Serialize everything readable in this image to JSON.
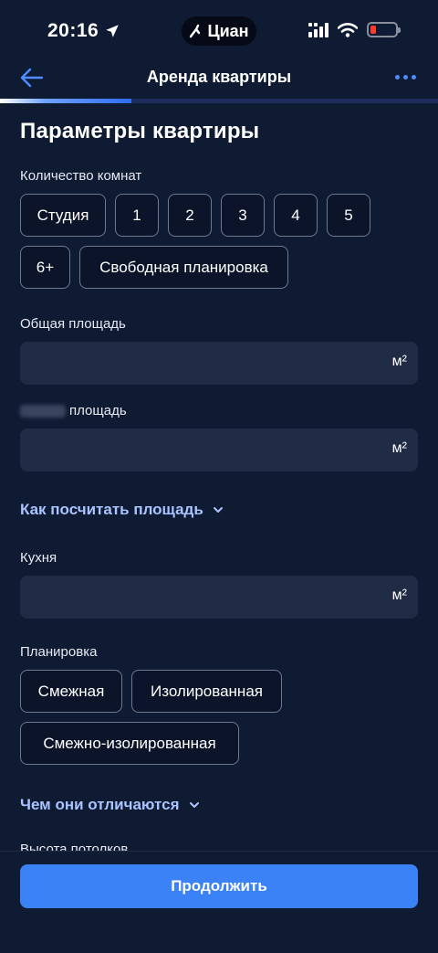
{
  "status": {
    "time": "20:16",
    "island_label": "Циан"
  },
  "header": {
    "title": "Аренда квартиры"
  },
  "progress": {
    "value_percent": 30
  },
  "page": {
    "title": "Параметры квартиры",
    "rooms": {
      "label": "Количество комнат",
      "options": [
        "Студия",
        "1",
        "2",
        "3",
        "4",
        "5",
        "6+",
        "Свободная планировка"
      ]
    },
    "total_area": {
      "label": "Общая площадь",
      "value": "",
      "unit": "м²"
    },
    "living_area": {
      "label": "площадь",
      "value": "",
      "unit": "м²"
    },
    "calc_link": "Как посчитать площадь",
    "kitchen": {
      "label": "Кухня",
      "value": "",
      "unit": "м²"
    },
    "layout": {
      "label": "Планировка",
      "options": [
        "Смежная",
        "Изолированная",
        "Смежно-изолированная"
      ]
    },
    "diff_link": "Чем они отличаются",
    "ceiling_label": "Высота потолков"
  },
  "footer": {
    "continue_label": "Продолжить"
  },
  "colors": {
    "background": "#0f1a33",
    "accent": "#3b82f6",
    "link": "#a9c4ff"
  }
}
